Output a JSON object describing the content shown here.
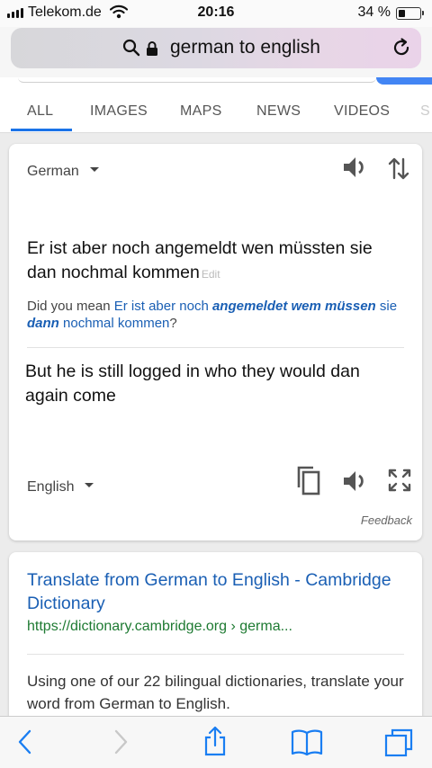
{
  "status_bar": {
    "carrier": "Telekom.de",
    "time": "20:16",
    "battery_text": "34 %",
    "battery_level": 0.34
  },
  "url_bar": {
    "query": "german to english"
  },
  "tabs": [
    {
      "label": "ALL",
      "active": true
    },
    {
      "label": "IMAGES",
      "active": false
    },
    {
      "label": "MAPS",
      "active": false
    },
    {
      "label": "NEWS",
      "active": false
    },
    {
      "label": "VIDEOS",
      "active": false
    },
    {
      "label": "S",
      "active": false
    }
  ],
  "translator": {
    "source_language": "German",
    "source_text": "Er ist aber noch angemeldt wen müssten sie dan nochmal kommen",
    "edit_label": "Edit",
    "did_you_mean": {
      "prefix": "Did you mean",
      "parts": [
        {
          "text": "Er ist aber noch",
          "bold": false
        },
        {
          "text": "angemeldet wem müssen",
          "bold": true
        },
        {
          "text": "sie",
          "bold": false
        },
        {
          "text": "dann",
          "bold": true
        },
        {
          "text": "nochmal kommen",
          "bold": false
        }
      ],
      "suffix": "?"
    },
    "translated_text": "But he is still logged in who they would dan again come",
    "target_language": "English",
    "feedback_label": "Feedback"
  },
  "result": {
    "title": "Translate from German to English - Cambridge Dictionary",
    "url": "https://dictionary.cambridge.org › germa...",
    "snippet": "Using one of our 22 bilingual dictionaries, translate your word from German to English."
  },
  "colors": {
    "link_blue": "#1a5fb4",
    "tab_active": "#1a73e8",
    "url_green": "#1e7a32",
    "toolbar_icon": "#1a7ef2"
  },
  "icons": {
    "search": "search-icon",
    "lock": "lock-icon",
    "reload": "reload-icon",
    "speaker": "speaker-icon",
    "swap": "swap-languages-icon",
    "copy": "copy-icon",
    "expand": "fullscreen-icon",
    "back": "back-icon",
    "forward": "forward-icon",
    "share": "share-icon",
    "bookmarks": "bookmarks-icon",
    "tabs": "tabs-icon"
  }
}
